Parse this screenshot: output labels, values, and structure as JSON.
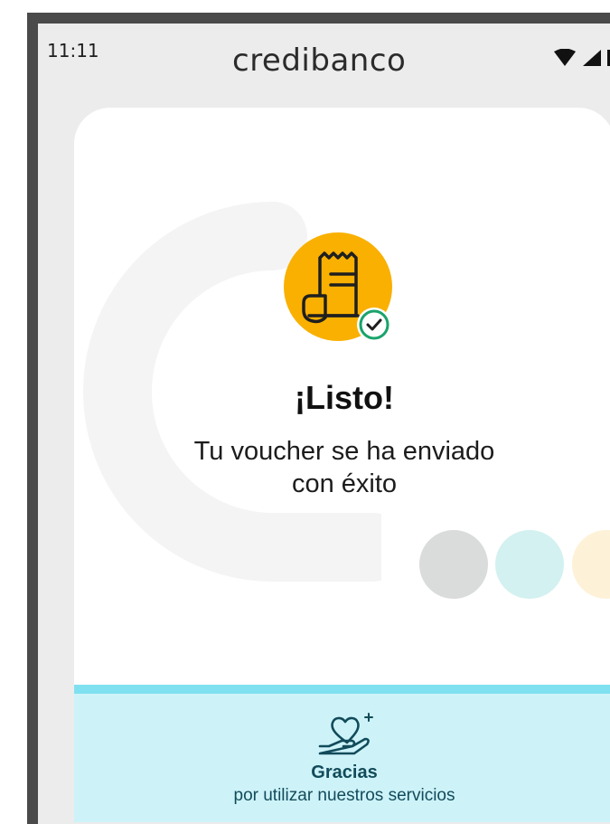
{
  "status_bar": {
    "time": "11:11",
    "brand": "credibanco",
    "icons": [
      "wifi-icon",
      "signal-icon",
      "battery-icon"
    ]
  },
  "confirmation": {
    "title": "¡Listo!",
    "message_line1": "Tu voucher se ha enviado",
    "message_line2": "con éxito",
    "icon": "receipt-check-icon"
  },
  "decor_colors": [
    "#d9dcdb",
    "#d3f1f0",
    "#fdf2d8"
  ],
  "footer": {
    "icon": "heart-hand-icon",
    "title": "Gracias",
    "subtitle": "por utilizar nuestros servicios"
  },
  "colors": {
    "accent_yellow": "#f9b000",
    "accent_green": "#1aa36b",
    "footer_bg": "#cdf3f9",
    "footer_border": "#7fe1f0",
    "footer_text": "#124b5a"
  }
}
